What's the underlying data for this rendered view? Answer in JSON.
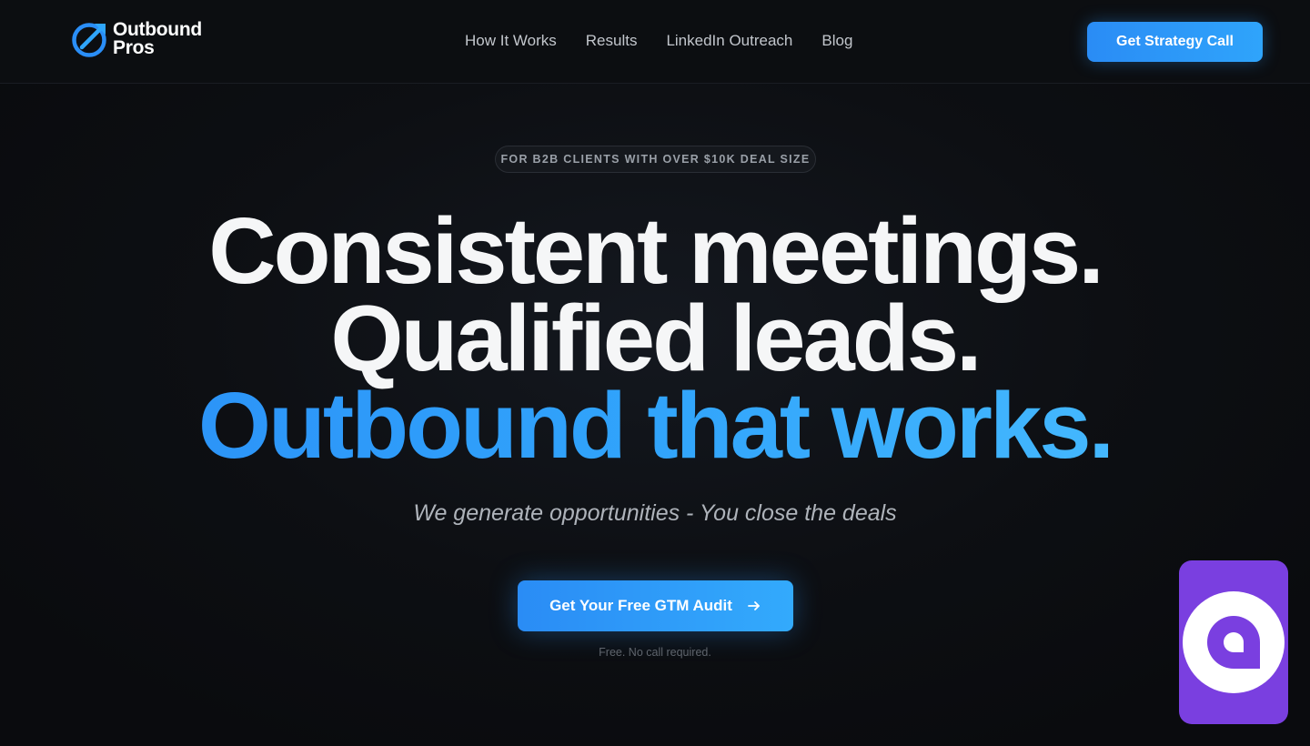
{
  "brand": {
    "name_line1": "Outbound",
    "name_line2": "Pros",
    "logo_icon": "target-arrow-icon",
    "accent": "#2a96fa"
  },
  "nav": {
    "items": [
      {
        "label": "How It Works"
      },
      {
        "label": "Results"
      },
      {
        "label": "LinkedIn Outreach"
      },
      {
        "label": "Blog"
      }
    ],
    "cta_label": "Get Strategy Call"
  },
  "hero": {
    "eyebrow": "FOR B2B CLIENTS WITH OVER $10K DEAL SIZE",
    "headline_line1": "Consistent meetings.",
    "headline_line2": "Qualified leads.",
    "headline_line3": "Outbound that works.",
    "subhead": "We generate opportunities - You close the deals",
    "cta_label": "Get Your Free GTM Audit",
    "cta_icon": "arrow-right-icon",
    "note": "Free. No call required."
  },
  "widget": {
    "icon": "chat-bubble-icon",
    "color": "#7a3fe0"
  }
}
